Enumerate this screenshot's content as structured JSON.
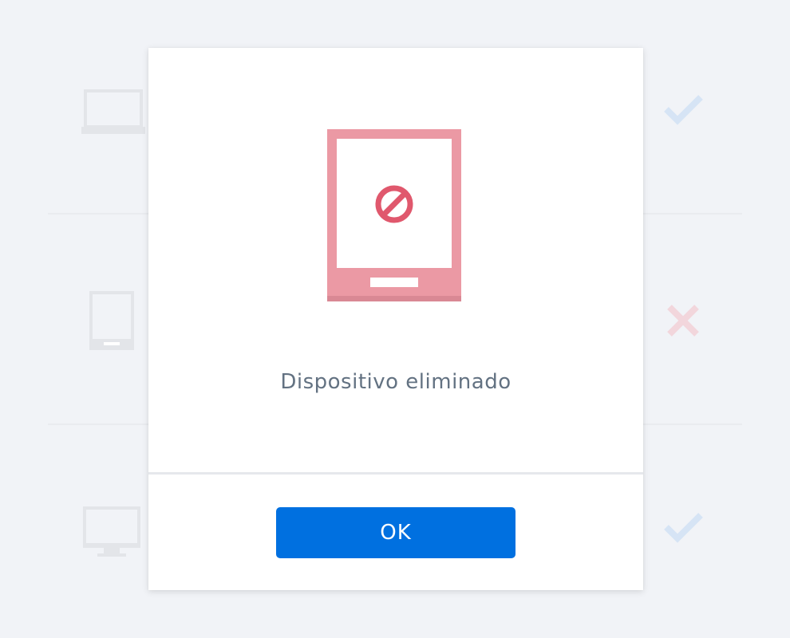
{
  "background": {
    "devices": [
      {
        "icon": "laptop-icon",
        "status_icon": "checkmark-icon",
        "status": "ok"
      },
      {
        "icon": "tablet-icon",
        "status_icon": "cross-icon",
        "status": "removed"
      },
      {
        "icon": "desktop-monitor-icon",
        "status_icon": "checkmark-icon",
        "status": "ok"
      }
    ]
  },
  "modal": {
    "illustration_icon": "tablet-blocked-icon",
    "message": "Dispositivo eliminado",
    "ok_label": "OK"
  },
  "colors": {
    "page_background": "#f1f3f7",
    "primary_button": "#0070e0",
    "message_text": "#637282",
    "tablet_pink": "#eb99a4",
    "blocked_red": "#e0586d",
    "check_blue": "#d6e4f5",
    "cross_pink": "#f2d6dc",
    "faded_device_gray": "#e3e5e9"
  }
}
